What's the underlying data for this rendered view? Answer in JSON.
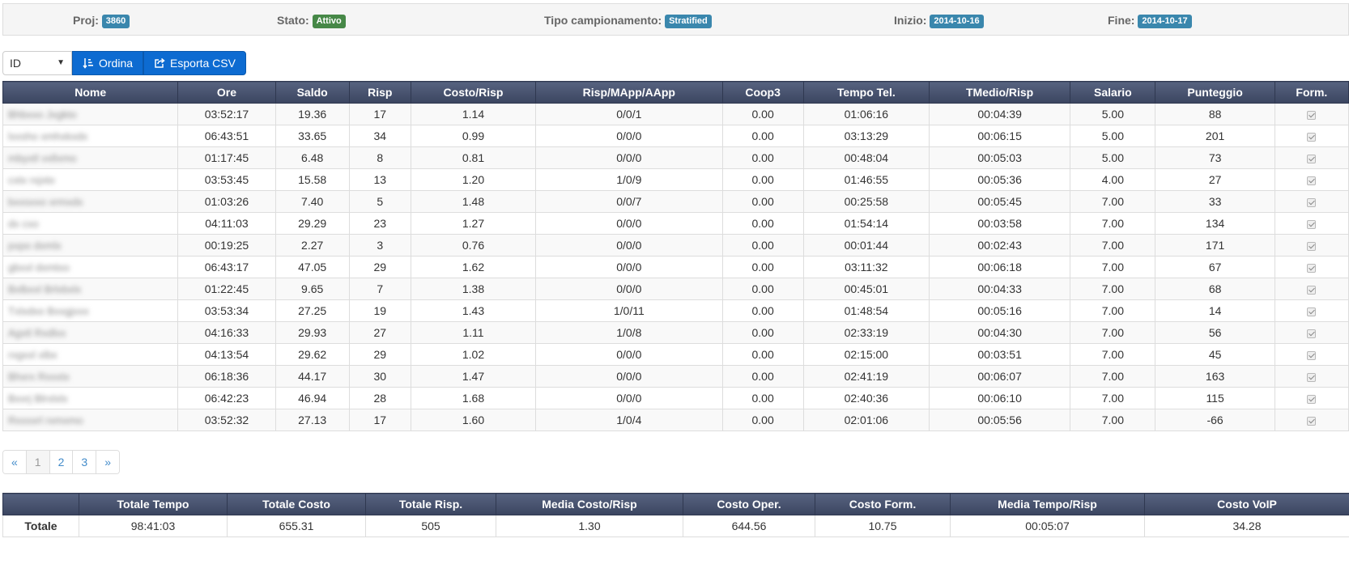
{
  "info": {
    "proj_label": "Proj:",
    "proj_value": "3860",
    "stato_label": "Stato:",
    "stato_value": "Attivo",
    "tipo_label": "Tipo campionamento:",
    "tipo_value": "Stratified",
    "inizio_label": "Inizio:",
    "inizio_value": "2014-10-16",
    "fine_label": "Fine:",
    "fine_value": "2014-10-17"
  },
  "toolbar": {
    "sort_select_value": "ID",
    "sort_button_label": "Ordina",
    "export_button_label": "Esporta CSV"
  },
  "main_table": {
    "headers": [
      "Nome",
      "Ore",
      "Saldo",
      "Risp",
      "Costo/Risp",
      "Risp/MApp/AApp",
      "Coop3",
      "Tempo Tel.",
      "TMedio/Risp",
      "Salario",
      "Punteggio",
      "Form."
    ],
    "rows": [
      {
        "nome": "Bhbxxo Jxgkto",
        "ore": "03:52:17",
        "saldo": "19.36",
        "risp": "17",
        "costo_risp": "1.14",
        "risp_mapp": "0/0/1",
        "coop3": "0.00",
        "tempo_tel": "01:06:16",
        "tmedio": "00:04:39",
        "salario": "5.00",
        "punteggio": "88",
        "form": true
      },
      {
        "nome": "lxxsho xmhxkxdx",
        "ore": "06:43:51",
        "saldo": "33.65",
        "risp": "34",
        "costo_risp": "0.99",
        "risp_mapp": "0/0/0",
        "coop3": "0.00",
        "tempo_tel": "03:13:29",
        "tmedio": "00:06:15",
        "salario": "5.00",
        "punteggio": "201",
        "form": true
      },
      {
        "nome": "mbyxtl vxllxmo",
        "ore": "01:17:45",
        "saldo": "6.48",
        "risp": "8",
        "costo_risp": "0.81",
        "risp_mapp": "0/0/0",
        "coop3": "0.00",
        "tempo_tel": "00:48:04",
        "tmedio": "00:05:03",
        "salario": "5.00",
        "punteggio": "73",
        "form": true
      },
      {
        "nome": "cxtx rxjxto",
        "ore": "03:53:45",
        "saldo": "15.58",
        "risp": "13",
        "costo_risp": "1.20",
        "risp_mapp": "1/0/9",
        "coop3": "0.00",
        "tempo_tel": "01:46:55",
        "tmedio": "00:05:36",
        "salario": "4.00",
        "punteggio": "27",
        "form": true
      },
      {
        "nome": "bxxsxxo xrmxdx",
        "ore": "01:03:26",
        "saldo": "7.40",
        "risp": "5",
        "costo_risp": "1.48",
        "risp_mapp": "0/0/7",
        "coop3": "0.00",
        "tempo_tel": "00:25:58",
        "tmedio": "00:05:45",
        "salario": "7.00",
        "punteggio": "33",
        "form": true
      },
      {
        "nome": "dx cxo",
        "ore": "04:11:03",
        "saldo": "29.29",
        "risp": "23",
        "costo_risp": "1.27",
        "risp_mapp": "0/0/0",
        "coop3": "0.00",
        "tempo_tel": "01:54:14",
        "tmedio": "00:03:58",
        "salario": "7.00",
        "punteggio": "134",
        "form": true
      },
      {
        "nome": "pxpo dxmlx",
        "ore": "00:19:25",
        "saldo": "2.27",
        "risp": "3",
        "costo_risp": "0.76",
        "risp_mapp": "0/0/0",
        "coop3": "0.00",
        "tempo_tel": "00:01:44",
        "tmedio": "00:02:43",
        "salario": "7.00",
        "punteggio": "171",
        "form": true
      },
      {
        "nome": "gbxxl dxmtxo",
        "ore": "06:43:17",
        "saldo": "47.05",
        "risp": "29",
        "costo_risp": "1.62",
        "risp_mapp": "0/0/0",
        "coop3": "0.00",
        "tempo_tel": "03:11:32",
        "tmedio": "00:06:18",
        "salario": "7.00",
        "punteggio": "67",
        "form": true
      },
      {
        "nome": "Bxlbxxl Brlxbxlx",
        "ore": "01:22:45",
        "saldo": "9.65",
        "risp": "7",
        "costo_risp": "1.38",
        "risp_mapp": "0/0/0",
        "coop3": "0.00",
        "tempo_tel": "00:45:01",
        "tmedio": "00:04:33",
        "salario": "7.00",
        "punteggio": "68",
        "form": true
      },
      {
        "nome": "Txlxdxo Bxxgjxxx",
        "ore": "03:53:34",
        "saldo": "27.25",
        "risp": "19",
        "costo_risp": "1.43",
        "risp_mapp": "1/0/11",
        "coop3": "0.00",
        "tempo_tel": "01:48:54",
        "tmedio": "00:05:16",
        "salario": "7.00",
        "punteggio": "14",
        "form": true
      },
      {
        "nome": "Agxtl Rxdlxx",
        "ore": "04:16:33",
        "saldo": "29.93",
        "risp": "27",
        "costo_risp": "1.11",
        "risp_mapp": "1/0/8",
        "coop3": "0.00",
        "tempo_tel": "02:33:19",
        "tmedio": "00:04:30",
        "salario": "7.00",
        "punteggio": "56",
        "form": true
      },
      {
        "nome": "rxgxxl xlbx",
        "ore": "04:13:54",
        "saldo": "29.62",
        "risp": "29",
        "costo_risp": "1.02",
        "risp_mapp": "0/0/0",
        "coop3": "0.00",
        "tempo_tel": "02:15:00",
        "tmedio": "00:03:51",
        "salario": "7.00",
        "punteggio": "45",
        "form": true
      },
      {
        "nome": "Bhxrx Rxxxtx",
        "ore": "06:18:36",
        "saldo": "44.17",
        "risp": "30",
        "costo_risp": "1.47",
        "risp_mapp": "0/0/0",
        "coop3": "0.00",
        "tempo_tel": "02:41:19",
        "tmedio": "00:06:07",
        "salario": "7.00",
        "punteggio": "163",
        "form": true
      },
      {
        "nome": "Bxxrj Blrxlxlx",
        "ore": "06:42:23",
        "saldo": "46.94",
        "risp": "28",
        "costo_risp": "1.68",
        "risp_mapp": "0/0/0",
        "coop3": "0.00",
        "tempo_tel": "02:40:36",
        "tmedio": "00:06:10",
        "salario": "7.00",
        "punteggio": "115",
        "form": true
      },
      {
        "nome": "Rxxxxrl rxmxmo",
        "ore": "03:52:32",
        "saldo": "27.13",
        "risp": "17",
        "costo_risp": "1.60",
        "risp_mapp": "1/0/4",
        "coop3": "0.00",
        "tempo_tel": "02:01:06",
        "tmedio": "00:05:56",
        "salario": "7.00",
        "punteggio": "-66",
        "form": true
      }
    ]
  },
  "pagination": {
    "prev": "«",
    "pages": [
      "1",
      "2",
      "3"
    ],
    "current_page": "1",
    "next": "»"
  },
  "totals_table": {
    "headers": [
      "",
      "Totale Tempo",
      "Totale Costo",
      "Totale Risp.",
      "Media Costo/Risp",
      "Costo Oper.",
      "Costo Form.",
      "Media Tempo/Risp",
      "Costo VoIP"
    ],
    "row": {
      "label": "Totale",
      "totale_tempo": "98:41:03",
      "totale_costo": "655.31",
      "totale_risp": "505",
      "media_costo_risp": "1.30",
      "costo_oper": "644.56",
      "costo_form": "10.75",
      "media_tempo_risp": "00:05:07",
      "costo_voip": "34.28"
    }
  }
}
